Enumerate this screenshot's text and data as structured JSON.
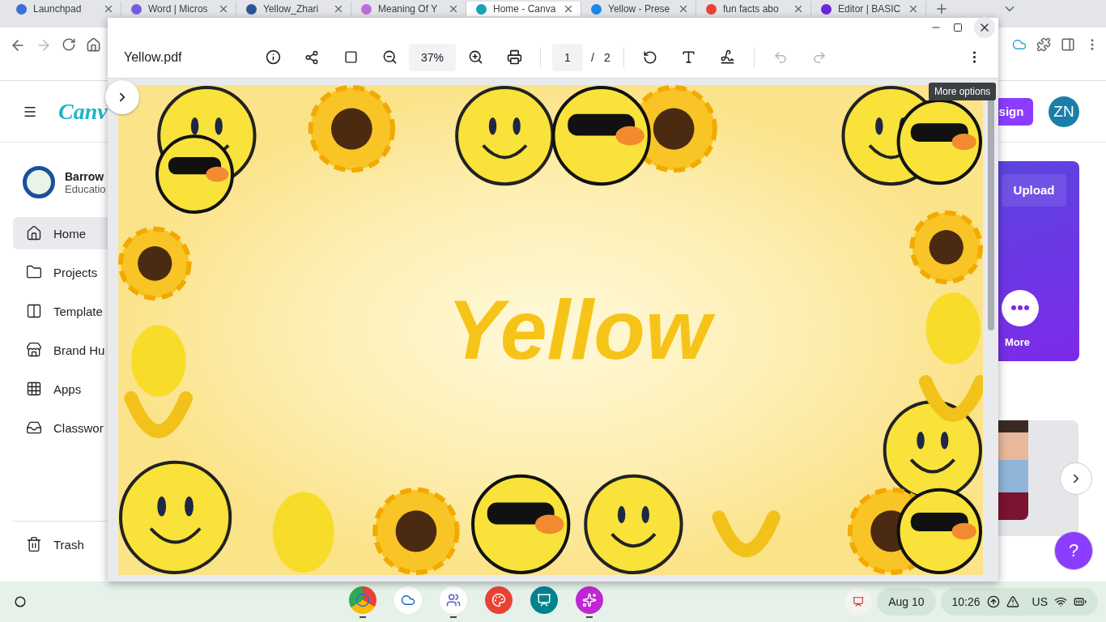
{
  "browser_tabs": [
    {
      "title": "Launchpad",
      "color": "#3b6fd6",
      "selected": false
    },
    {
      "title": "Word | Micros",
      "color": "#7b5ce0",
      "selected": false
    },
    {
      "title": "Yellow_Zhari",
      "color": "#2b579a",
      "selected": false
    },
    {
      "title": "Meaning Of Y",
      "color": "#c36bd8",
      "selected": false
    },
    {
      "title": "Home - Canva",
      "color": "#19a3b6",
      "selected": true
    },
    {
      "title": "Yellow - Prese",
      "color": "#1e88e5",
      "selected": false
    },
    {
      "title": "fun facts abo",
      "color": "#ea4335",
      "selected": false
    },
    {
      "title": "Editor | BASIC",
      "color": "#6d28d9",
      "selected": false
    }
  ],
  "browser_toolbar": {
    "forward_disabled": true
  },
  "canva": {
    "logo": "Canv",
    "header_button": "sign",
    "avatar": "ZN",
    "org": {
      "name": "Barrow",
      "subtitle": "Educatio"
    },
    "nav": [
      {
        "label": "Home",
        "selected": true
      },
      {
        "label": "Projects",
        "selected": false
      },
      {
        "label": "Template",
        "selected": false
      },
      {
        "label": "Brand Hu",
        "selected": false
      },
      {
        "label": "Apps",
        "selected": false
      },
      {
        "label": "Classwor",
        "selected": false
      }
    ],
    "trash": "Trash",
    "upload_button": "Upload",
    "more_label": "More",
    "help_button": "?"
  },
  "pdf_viewer": {
    "file_name": "Yellow.pdf",
    "zoom": "37%",
    "page": "1",
    "page_separator": "/",
    "page_count": "2",
    "undo_disabled": true,
    "redo_disabled": true,
    "tooltip": "More options",
    "page_title": "Yellow"
  },
  "taskbar": {
    "apps": [
      {
        "running": true
      },
      {
        "running": false
      },
      {
        "running": true
      },
      {
        "running": false
      },
      {
        "running": false
      },
      {
        "running": true
      }
    ],
    "date": "Aug 10",
    "time": "10:26",
    "keyboard": "US"
  }
}
